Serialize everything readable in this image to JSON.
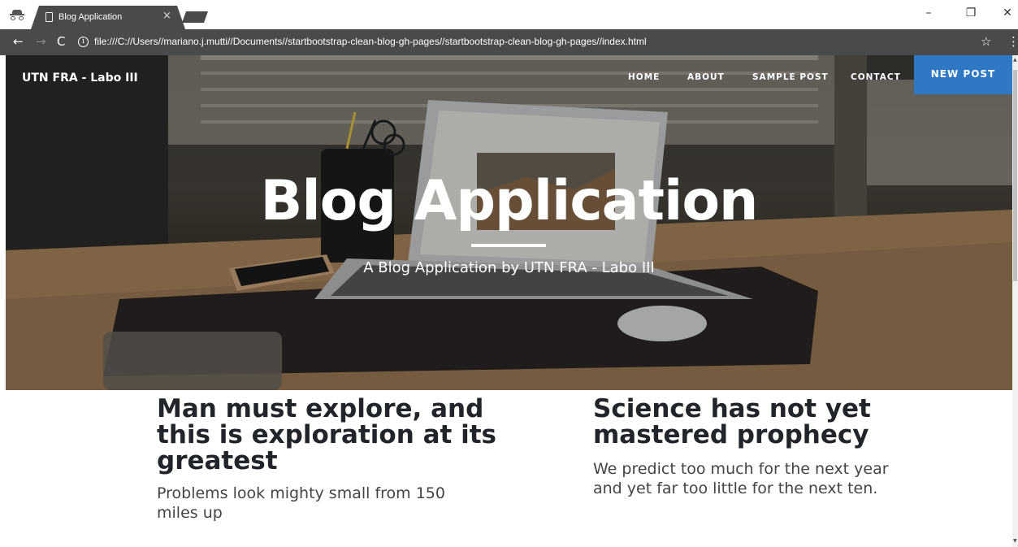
{
  "browser": {
    "tab_title": "Blog Application",
    "tab_close": "×",
    "url": "file:///C://Users//mariano.j.mutti//Documents//startbootstrap-clean-blog-gh-pages//startbootstrap-clean-blog-gh-pages//index.html",
    "back": "←",
    "forward": "→",
    "reload": "C",
    "info": "i",
    "star": "☆",
    "menu": "⋮",
    "minimize": "–",
    "maximize": "❐",
    "close": "✕"
  },
  "nav": {
    "brand": "UTN FRA - Labo III",
    "links": [
      "HOME",
      "ABOUT",
      "SAMPLE POST",
      "CONTACT"
    ],
    "new_post": "NEW POST"
  },
  "hero": {
    "title": "Blog Application",
    "subtitle": "A Blog Application by UTN FRA - Labo III"
  },
  "posts": [
    {
      "title": "Man must explore, and this is exploration at its greatest",
      "subtitle": "Problems look mighty small from 150 miles up"
    },
    {
      "title": "Science has not yet mastered prophecy",
      "subtitle": "We predict too much for the next year and yet far too little for the next ten."
    }
  ],
  "colors": {
    "accent": "#2f79c4",
    "browser_bar": "#4a4a4a",
    "heading": "#212529"
  },
  "icons": {
    "incognito": "incognito-icon",
    "page": "page-icon",
    "info": "info-icon"
  }
}
